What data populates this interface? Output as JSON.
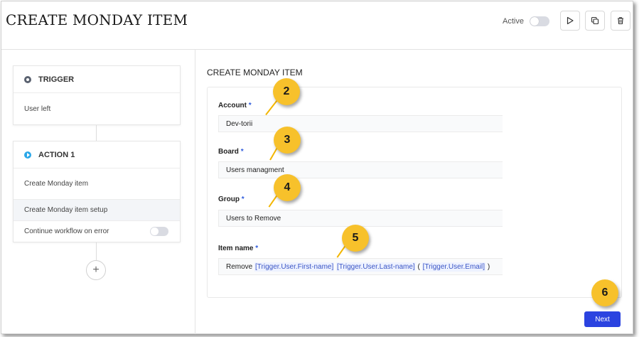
{
  "header": {
    "title": "CREATE MONDAY ITEM",
    "active_label": "Active",
    "active_on": false,
    "icons": [
      "play-icon",
      "copy-icon",
      "trash-icon"
    ]
  },
  "workflow": {
    "trigger": {
      "label": "TRIGGER",
      "event": "User left"
    },
    "action": {
      "label": "ACTION 1",
      "name": "Create Monday item",
      "setup": "Create Monday item setup",
      "continue_on_error": "Continue workflow on error",
      "continue_on_error_on": false
    },
    "add_button": "+"
  },
  "form": {
    "section_title": "CREATE MONDAY ITEM",
    "required_mark": "*",
    "account": {
      "label": "Account",
      "value": "Dev-torii"
    },
    "board": {
      "label": "Board",
      "value": "Users managment"
    },
    "group": {
      "label": "Group",
      "value": "Users to Remove"
    },
    "item_name": {
      "label": "Item name",
      "prefix": "Remove",
      "var_first": "[Trigger.User.First-name]",
      "var_last": "[Trigger.User.Last-name]",
      "open_paren": "(",
      "var_email": "[Trigger.User.Email]",
      "close_paren": ")"
    },
    "next_label": "Next"
  },
  "annotations": [
    "2",
    "3",
    "4",
    "5",
    "6"
  ],
  "colors": {
    "accent": "#2b43e0",
    "badge": "#f7c12b",
    "action_dot": "#2aa7e8",
    "trigger_dot": "#5a6270"
  }
}
